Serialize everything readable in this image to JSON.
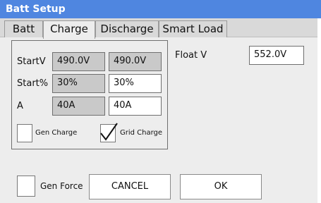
{
  "window": {
    "title": "Batt Setup"
  },
  "tabs": [
    {
      "label": "Batt",
      "active": false
    },
    {
      "label": "Charge",
      "active": true
    },
    {
      "label": "Discharge",
      "active": false
    },
    {
      "label": "Smart Load",
      "active": false
    }
  ],
  "charge": {
    "rows": [
      {
        "label": "StartV",
        "gen_value": "490.0V",
        "grid_value": "490.0V"
      },
      {
        "label": "Start%",
        "gen_value": "30%",
        "grid_value": "30%"
      },
      {
        "label": "A",
        "gen_value": "40A",
        "grid_value": "40A"
      }
    ],
    "gen_charge": {
      "label": "Gen Charge",
      "checked": false
    },
    "grid_charge": {
      "label": "Grid Charge",
      "checked": true
    }
  },
  "float": {
    "label": "Float V",
    "value": "552.0V"
  },
  "footer": {
    "gen_force": {
      "label": "Gen Force",
      "checked": false
    },
    "cancel_label": "CANCEL",
    "ok_label": "OK"
  },
  "colors": {
    "title_bar": "#4f86e0",
    "panel": "#ededed",
    "readonly_field": "#c9c9c9"
  }
}
